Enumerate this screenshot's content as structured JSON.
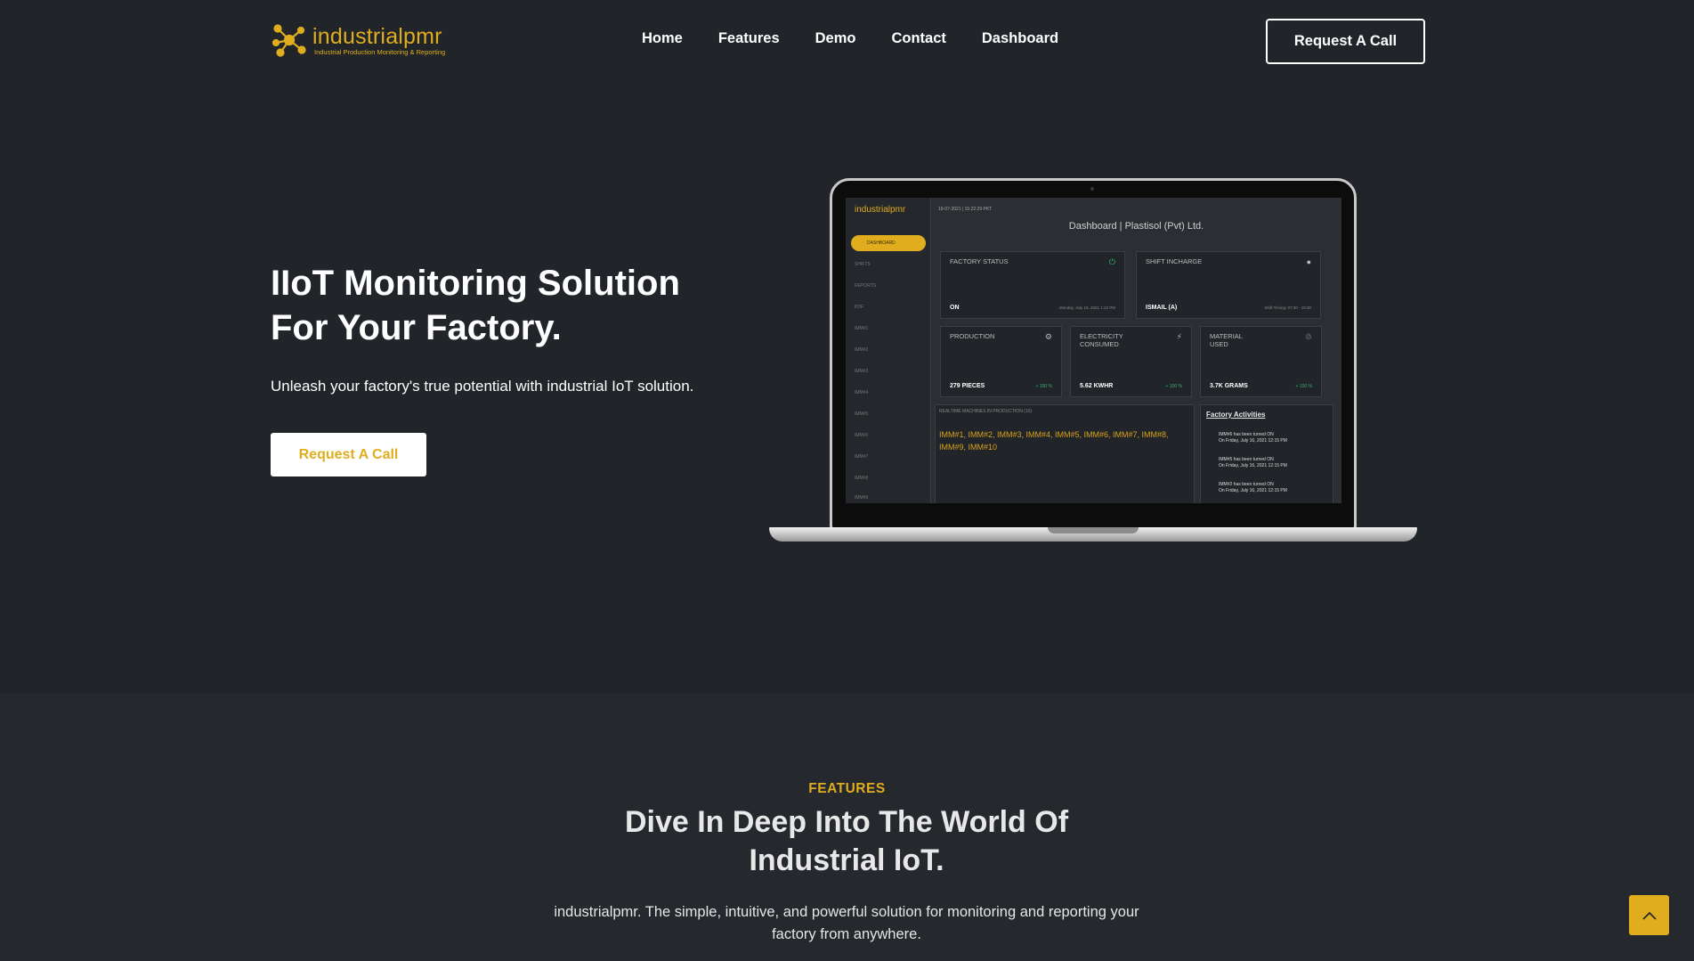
{
  "brand": {
    "name": "industrialpmr",
    "tagline": "Industrial Production Monitoring & Reporting",
    "accent_color": "#e0ad1f",
    "background_color": "#212529"
  },
  "nav": {
    "items": [
      "Home",
      "Features",
      "Demo",
      "Contact",
      "Dashboard"
    ],
    "cta_label": "Request A Call"
  },
  "hero": {
    "title_line1": "IIoT Monitoring Solution",
    "title_line2": "For Your Factory.",
    "subtitle": "Unleash your factory's true potential with industrial IoT solution.",
    "cta_label": "Request A Call"
  },
  "dashboard_preview": {
    "logo": "industrialpmr",
    "timestamp": "19-07-2021 | 15:22:29 PKT",
    "sidebar_active": "DASHBOARD",
    "sidebar_items": [
      "SHIFTS",
      "REPORTS",
      "PDF",
      "IMM#1",
      "IMM#2",
      "IMM#3",
      "IMM#4",
      "IMM#5",
      "IMM#6",
      "IMM#7",
      "IMM#8",
      "IMM#9"
    ],
    "title": "Dashboard | Plastisol (Pvt) Ltd.",
    "factory_status_label": "FACTORY STATUS",
    "factory_status_value": "ON",
    "factory_status_date": "Monday, July 19, 2021 1:22 PM",
    "shift_label": "SHIFT INCHARGE",
    "shift_value": "ISMAIL (A)",
    "shift_timing": "Shift Timing: 07:30 - 19:30",
    "production_label": "PRODUCTION",
    "production_value": "279 PIECES",
    "production_change": "+ 100 %",
    "electricity_label_1": "ELECTRICITY",
    "electricity_label_2": "CONSUMED",
    "electricity_value": "5.62 KWHR",
    "electricity_change": "+ 100 %",
    "material_label_1": "MATERIAL",
    "material_label_2": "USED",
    "material_value": "3.7K GRAMS",
    "material_change": "+ 100 %",
    "realtime_label": "REALTIME MACHINES IN PRODUCTION (10)",
    "realtime_machines": "IMM#1, IMM#2, IMM#3, IMM#4, IMM#5, IMM#6, IMM#7, IMM#8, IMM#9, IMM#10",
    "activities_title": "Factory Activities",
    "activities": [
      {
        "text": "IMM#6 has been turned ON",
        "when": "On Friday, July 16, 2021 12:15 PM"
      },
      {
        "text": "IMM#5 has been turned ON",
        "when": "On Friday, July 16, 2021 12:15 PM"
      },
      {
        "text": "IMM#2 has been turned ON",
        "when": "On Friday, July 16, 2021 12:15 PM"
      }
    ]
  },
  "features": {
    "eyebrow": "FEATURES",
    "title_line1": "Dive In Deep Into The World Of",
    "title_line2": "Industrial IoT.",
    "description_line1": "industrialpmr. The simple, intuitive, and powerful solution for monitoring and reporting your",
    "description_line2": "factory from anywhere."
  },
  "icons": {
    "logo": "network-nodes-icon",
    "back_to_top": "chevron-up-icon"
  }
}
